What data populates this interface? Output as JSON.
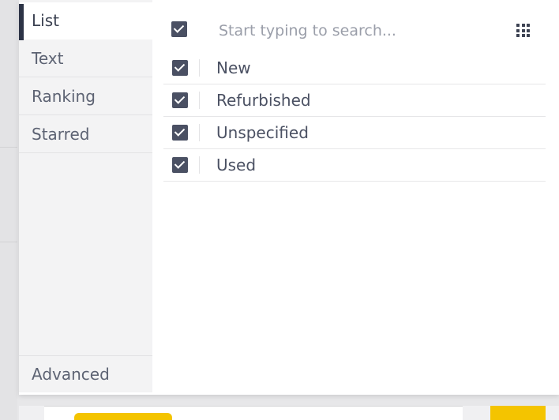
{
  "tabs": [
    {
      "label": "List",
      "active": true
    },
    {
      "label": "Text",
      "active": false
    },
    {
      "label": "Ranking",
      "active": false
    },
    {
      "label": "Starred",
      "active": false
    }
  ],
  "advanced_tab": {
    "label": "Advanced"
  },
  "search": {
    "placeholder": "Start typing to search...",
    "select_all_checked": true,
    "grid_icon": "grid-dots-icon"
  },
  "items": [
    {
      "label": "New",
      "checked": true
    },
    {
      "label": "Refurbished",
      "checked": true
    },
    {
      "label": "Unspecified",
      "checked": true
    },
    {
      "label": "Used",
      "checked": true
    }
  ],
  "colors": {
    "accent_yellow": "#f4c400",
    "checkbox": "#4a5063",
    "active_tab_marker": "#2c3346"
  }
}
